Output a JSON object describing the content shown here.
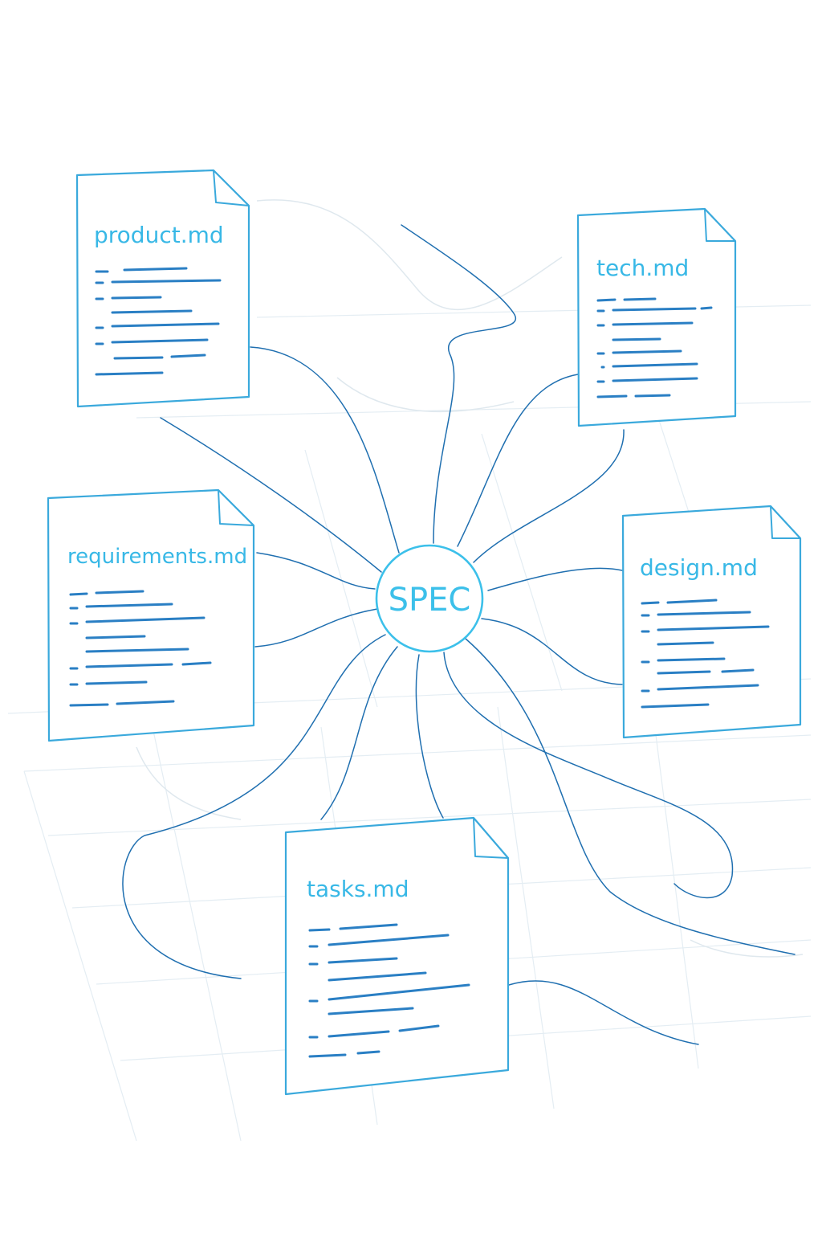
{
  "diagram": {
    "hub": {
      "label": "SPEC"
    },
    "documents": [
      {
        "id": "product",
        "title": "product.md"
      },
      {
        "id": "tech",
        "title": "tech.md"
      },
      {
        "id": "requirements",
        "title": "requirements.md"
      },
      {
        "id": "design",
        "title": "design.md"
      },
      {
        "id": "tasks",
        "title": "tasks.md"
      }
    ]
  },
  "colors": {
    "accent": "#38b8e6",
    "line": "#1f6fb0",
    "grid": "#e4edf3",
    "background": "#ffffff"
  }
}
